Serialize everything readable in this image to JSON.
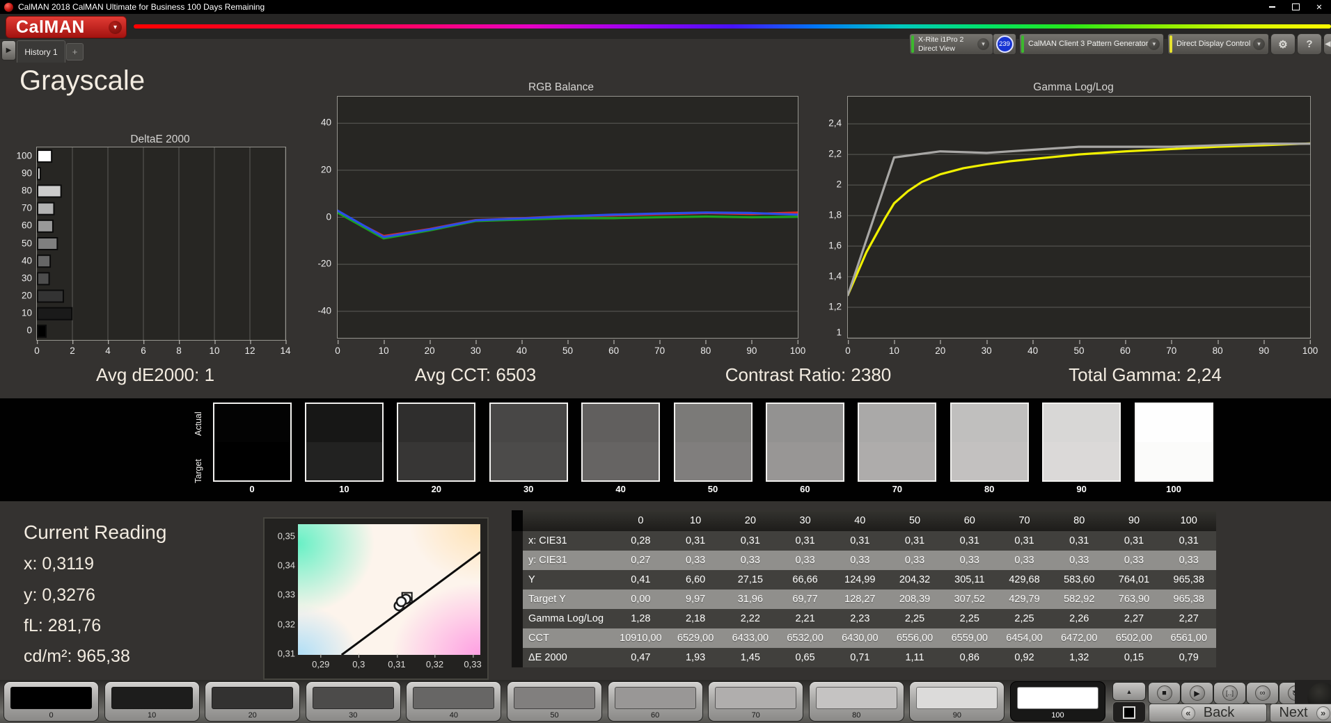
{
  "window": {
    "title": "CalMAN 2018 CalMAN Ultimate for Business 100 Days Remaining"
  },
  "brand": {
    "logo": "CalMAN",
    "accent_red": "#c6201c"
  },
  "tabs": {
    "history": "History 1"
  },
  "devices": {
    "meter": {
      "line1": "X-Rite i1Pro 2",
      "line2": "Direct View",
      "badge": "239",
      "status_color": "#3cb82e"
    },
    "source": {
      "label": "CalMAN Client 3 Pattern Generator",
      "status_color": "#3cb82e"
    },
    "display": {
      "label": "Direct Display Control",
      "status_color": "#e6e230"
    }
  },
  "icons": {
    "close": "✕",
    "dropdown": "▾",
    "gear": "⚙",
    "help": "?",
    "collapse": "◀",
    "add": "+",
    "nav_play": "▶",
    "stop": "■",
    "play": "▶",
    "continuous": "[‥]",
    "infinity": "∞",
    "refresh": "↻",
    "up": "▲",
    "back_chev": "«",
    "next_chev": "»"
  },
  "page": {
    "title": "Grayscale"
  },
  "stats": {
    "de2000": "Avg dE2000: 1",
    "cct": "Avg CCT: 6503",
    "contrast": "Contrast Ratio: 2380",
    "gamma": "Total Gamma: 2,24"
  },
  "chart_data": [
    {
      "type": "bar",
      "title": "DeltaE 2000",
      "orientation": "horizontal",
      "categories": [
        0,
        10,
        20,
        30,
        40,
        50,
        60,
        70,
        80,
        90,
        100
      ],
      "values": [
        0.47,
        1.93,
        1.45,
        0.65,
        0.71,
        1.11,
        0.86,
        0.92,
        1.32,
        0.15,
        0.79
      ],
      "xlim": [
        0,
        14
      ],
      "x_ticks": [
        0,
        2,
        4,
        6,
        8,
        10,
        12,
        14
      ],
      "layout": "100 at top, 0 at bottom; each bar filled with the gray of its signal level"
    },
    {
      "type": "line",
      "title": "RGB Balance",
      "x": [
        0,
        10,
        20,
        30,
        40,
        50,
        60,
        70,
        80,
        90,
        100
      ],
      "series": [
        {
          "name": "Red",
          "color": "#e02b27",
          "values": [
            2.2,
            -8.0,
            -5.0,
            -1.2,
            -0.4,
            0.5,
            0.8,
            1.3,
            1.8,
            1.4,
            2.0
          ]
        },
        {
          "name": "Green",
          "color": "#1ba31f",
          "values": [
            2.0,
            -9.0,
            -5.6,
            -1.6,
            -1.0,
            -0.4,
            -0.4,
            0.0,
            0.3,
            0.0,
            0.2
          ]
        },
        {
          "name": "Blue",
          "color": "#2b4de8",
          "values": [
            2.8,
            -8.4,
            -5.2,
            -1.3,
            -0.5,
            0.4,
            1.1,
            1.6,
            2.0,
            1.8,
            1.1
          ]
        }
      ],
      "ylim": [
        -51.3,
        51.3
      ],
      "y_ticks": [
        {
          "value": 40,
          "label": "40"
        },
        {
          "value": 20,
          "label": "20"
        },
        {
          "value": 0,
          "label": "0"
        },
        {
          "value": -20,
          "label": "-20"
        },
        {
          "value": -40,
          "label": "-40"
        }
      ],
      "x_ticks": [
        0,
        10,
        20,
        30,
        40,
        50,
        60,
        70,
        80,
        90,
        100
      ]
    },
    {
      "type": "line",
      "title": "Gamma Log/Log",
      "series": [
        {
          "name": "Target gamma",
          "color": "#f0f000",
          "x": [
            0,
            2,
            4,
            6,
            8,
            10,
            13,
            16,
            20,
            25,
            30,
            35,
            40,
            50,
            60,
            70,
            80,
            90,
            100
          ],
          "values": [
            1.28,
            1.42,
            1.56,
            1.67,
            1.78,
            1.88,
            1.96,
            2.02,
            2.07,
            2.11,
            2.135,
            2.155,
            2.17,
            2.2,
            2.22,
            2.235,
            2.25,
            2.26,
            2.272
          ]
        },
        {
          "name": "Measured gamma",
          "color": "#a8a7a5",
          "x": [
            0,
            10,
            20,
            30,
            40,
            50,
            60,
            70,
            80,
            90,
            100
          ],
          "values": [
            1.28,
            2.18,
            2.22,
            2.21,
            2.23,
            2.25,
            2.25,
            2.25,
            2.26,
            2.27,
            2.27
          ]
        }
      ],
      "ylim": [
        1.0,
        2.578
      ],
      "y_ticks": [
        {
          "value": 2.4,
          "label": "2,4"
        },
        {
          "value": 2.2,
          "label": "2,2"
        },
        {
          "value": 2,
          "label": "2"
        },
        {
          "value": 1.8,
          "label": "1,8"
        },
        {
          "value": 1.6,
          "label": "1,6"
        },
        {
          "value": 1.4,
          "label": "1,4"
        },
        {
          "value": 1.2,
          "label": "1,2"
        },
        {
          "value": 1,
          "label": "1"
        }
      ],
      "x_ticks": [
        0,
        10,
        20,
        30,
        40,
        50,
        60,
        70,
        80,
        90,
        100
      ]
    },
    {
      "type": "scatter",
      "x_range": [
        0.284,
        0.332
      ],
      "y_range": [
        0.3095,
        0.354
      ],
      "x_ticks": [
        {
          "value": 0.29,
          "label": "0,29"
        },
        {
          "value": 0.3,
          "label": "0,3"
        },
        {
          "value": 0.31,
          "label": "0,31"
        },
        {
          "value": 0.32,
          "label": "0,32"
        },
        {
          "value": 0.33,
          "label": "0,33"
        }
      ],
      "y_ticks": [
        {
          "value": 0.35,
          "label": "0,35"
        },
        {
          "value": 0.34,
          "label": "0,34"
        },
        {
          "value": 0.33,
          "label": "0,33"
        },
        {
          "value": 0.32,
          "label": "0,32"
        },
        {
          "value": 0.31,
          "label": "0,31"
        }
      ],
      "points": [
        {
          "x": 0.3106,
          "y": 0.3262
        },
        {
          "x": 0.3124,
          "y": 0.3285
        },
        {
          "x": 0.3112,
          "y": 0.3276
        }
      ],
      "target_square": {
        "x": 0.3127,
        "y": 0.329
      },
      "locus_line": [
        {
          "x": 0.2955,
          "y": 0.3095
        },
        {
          "x": 0.332,
          "y": 0.3445
        }
      ]
    }
  ],
  "swatches": {
    "actual_label": "Actual",
    "target_label": "Target",
    "levels": [
      "0",
      "10",
      "20",
      "30",
      "40",
      "50",
      "60",
      "70",
      "80",
      "90",
      "100"
    ],
    "actual_colors": [
      "#030303",
      "#171716",
      "#2f2e2d",
      "#484746",
      "#615f5e",
      "#7b7a78",
      "#939291",
      "#aaa9a8",
      "#c0bfbe",
      "#d8d7d6",
      "#fefefe"
    ],
    "target_colors": [
      "#000000",
      "#222221",
      "#373635",
      "#4c4b4a",
      "#666463",
      "#807e7d",
      "#989695",
      "#aeacab",
      "#c3c1c0",
      "#dbd9d8",
      "#fbfbfa"
    ]
  },
  "current_reading": {
    "title": "Current Reading",
    "x": "x: 0,3119",
    "y": "y: 0,3276",
    "fl": "fL: 281,76",
    "cdm2": "cd/m²: 965,38"
  },
  "table": {
    "columns": [
      "0",
      "10",
      "20",
      "30",
      "40",
      "50",
      "60",
      "70",
      "80",
      "90",
      "100"
    ],
    "rows": [
      {
        "label": "x: CIE31",
        "values": [
          "0,28",
          "0,31",
          "0,31",
          "0,31",
          "0,31",
          "0,31",
          "0,31",
          "0,31",
          "0,31",
          "0,31",
          "0,31"
        ]
      },
      {
        "label": "y: CIE31",
        "values": [
          "0,27",
          "0,33",
          "0,33",
          "0,33",
          "0,33",
          "0,33",
          "0,33",
          "0,33",
          "0,33",
          "0,33",
          "0,33"
        ]
      },
      {
        "label": "Y",
        "values": [
          "0,41",
          "6,60",
          "27,15",
          "66,66",
          "124,99",
          "204,32",
          "305,11",
          "429,68",
          "583,60",
          "764,01",
          "965,38"
        ]
      },
      {
        "label": "Target Y",
        "values": [
          "0,00",
          "9,97",
          "31,96",
          "69,77",
          "128,27",
          "208,39",
          "307,52",
          "429,79",
          "582,92",
          "763,90",
          "965,38"
        ]
      },
      {
        "label": "Gamma Log/Log",
        "values": [
          "1,28",
          "2,18",
          "2,22",
          "2,21",
          "2,23",
          "2,25",
          "2,25",
          "2,25",
          "2,26",
          "2,27",
          "2,27"
        ]
      },
      {
        "label": "CCT",
        "values": [
          "10910,00",
          "6529,00",
          "6433,00",
          "6532,00",
          "6430,00",
          "6556,00",
          "6559,00",
          "6454,00",
          "6472,00",
          "6502,00",
          "6561,00"
        ]
      },
      {
        "label": "ΔE 2000",
        "values": [
          "0,47",
          "1,93",
          "1,45",
          "0,65",
          "0,71",
          "1,11",
          "0,86",
          "0,92",
          "1,32",
          "0,15",
          "0,79"
        ]
      }
    ]
  },
  "bottom": {
    "levels": [
      "0",
      "10",
      "20",
      "30",
      "40",
      "50",
      "60",
      "70",
      "80",
      "90",
      "100"
    ],
    "colors": [
      "#000000",
      "#1d1d1c",
      "#333231",
      "#4c4b4a",
      "#676665",
      "#817f7e",
      "#999796",
      "#b0aead",
      "#c5c3c2",
      "#dcdbda",
      "#ffffff"
    ],
    "selected": "100",
    "back": "Back",
    "next": "Next"
  }
}
